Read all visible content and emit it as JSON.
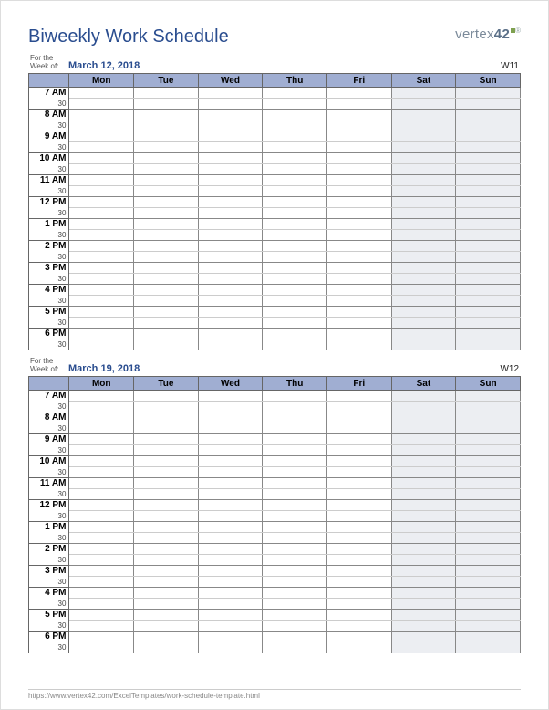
{
  "title": "Biweekly Work Schedule",
  "brand": {
    "name_a": "vertex",
    "name_b": "42"
  },
  "days": [
    "Mon",
    "Tue",
    "Wed",
    "Thu",
    "Fri",
    "Sat",
    "Sun"
  ],
  "week_of_label": "For the\nWeek of:",
  "half_label": ":30",
  "hours": [
    "7 AM",
    "8 AM",
    "9 AM",
    "10 AM",
    "11 AM",
    "12 PM",
    "1 PM",
    "2 PM",
    "3 PM",
    "4 PM",
    "5 PM",
    "6 PM"
  ],
  "weeks": [
    {
      "date": "March 12, 2018",
      "num": "W11"
    },
    {
      "date": "March 19, 2018",
      "num": "W12"
    }
  ],
  "footer_url": "https://www.vertex42.com/ExcelTemplates/work-schedule-template.html"
}
